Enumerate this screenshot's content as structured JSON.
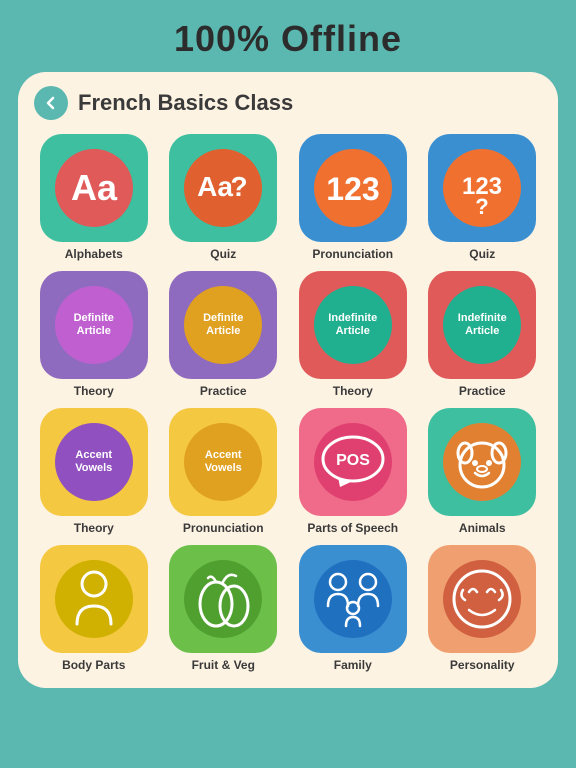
{
  "page": {
    "heading": "100% Offline",
    "card_title": "French Basics Class",
    "back_label": "back"
  },
  "grid": [
    {
      "id": "alphabets",
      "label": "Alphabets",
      "box_color": "box-green",
      "circle_color": "circle-red",
      "icon_type": "aa",
      "icon_text": "Aa"
    },
    {
      "id": "quiz1",
      "label": "Quiz",
      "box_color": "box-teal",
      "circle_color": "circle-redlt",
      "icon_type": "aa-q",
      "icon_text": "Aa?"
    },
    {
      "id": "pronunciation",
      "label": "Pronunciation",
      "box_color": "box-blue",
      "circle_color": "circle-orange",
      "icon_type": "num",
      "icon_text": "123"
    },
    {
      "id": "quiz2",
      "label": "Quiz",
      "box_color": "box-bluedk",
      "circle_color": "circle-orangelt",
      "icon_type": "num-q",
      "icon_text": "123?"
    },
    {
      "id": "def-article-theory",
      "label": "Theory",
      "box_color": "box-purple",
      "circle_color": "circle-purple",
      "icon_type": "text",
      "icon_text": "Definite\nArticle"
    },
    {
      "id": "def-article-practice",
      "label": "Practice",
      "box_color": "box-purpledk",
      "circle_color": "circle-purpleyellow",
      "icon_type": "text",
      "icon_text": "Definite\nArticle"
    },
    {
      "id": "indef-article-theory",
      "label": "Theory",
      "box_color": "box-red",
      "circle_color": "circle-teal",
      "icon_type": "text",
      "icon_text": "Indefinite\nArticle"
    },
    {
      "id": "indef-article-practice",
      "label": "Practice",
      "box_color": "box-reddk",
      "circle_color": "circle-tealgreen",
      "icon_type": "text",
      "icon_text": "Indefinite\nArticle"
    },
    {
      "id": "accent-vowels-theory",
      "label": "Theory",
      "box_color": "box-yellow",
      "circle_color": "circle-purpledark",
      "icon_type": "text",
      "icon_text": "Accent\nVowels"
    },
    {
      "id": "accent-vowels-pronunciation",
      "label": "Pronunciation",
      "box_color": "box-yellowdk",
      "circle_color": "circle-yellowlt",
      "icon_type": "text",
      "icon_text": "Accent\nVowels"
    },
    {
      "id": "parts-of-speech",
      "label": "Parts of Speech",
      "box_color": "box-pink",
      "circle_color": "circle-pink",
      "icon_type": "pos",
      "icon_text": "POS"
    },
    {
      "id": "animals",
      "label": "Animals",
      "box_color": "box-teallt",
      "circle_color": "circle-orange2",
      "icon_type": "dog",
      "icon_text": "🐶"
    },
    {
      "id": "body-parts",
      "label": "Body Parts",
      "box_color": "box-yw2",
      "circle_color": "circle-yellow2",
      "icon_type": "person",
      "icon_text": "👤"
    },
    {
      "id": "fruit-veg",
      "label": "Fruit & Veg",
      "box_color": "box-green2",
      "circle_color": "circle-green3",
      "icon_type": "fruit",
      "icon_text": "🍐"
    },
    {
      "id": "family",
      "label": "Family",
      "box_color": "box-teal2",
      "circle_color": "circle-blue3",
      "icon_type": "family",
      "icon_text": "👨‍👩‍👧"
    },
    {
      "id": "personality",
      "label": "Personality",
      "box_color": "box-peach",
      "circle_color": "circle-peach2",
      "icon_type": "face",
      "icon_text": "😌"
    }
  ]
}
